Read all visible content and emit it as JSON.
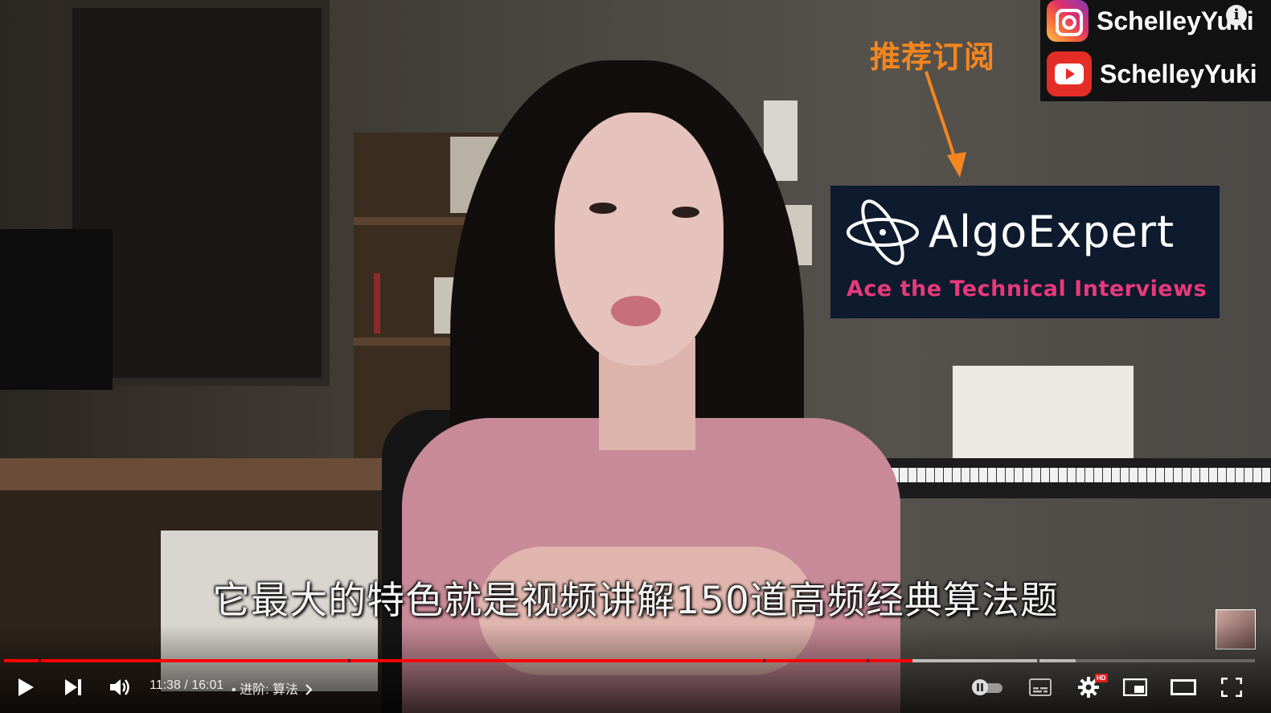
{
  "overlay": {
    "recommend_label": "推荐订阅",
    "social": [
      {
        "platform": "instagram",
        "icon": "instagram-icon",
        "handle": "SchelleyYuki"
      },
      {
        "platform": "youtube",
        "icon": "youtube-icon",
        "handle": "SchelleyYuki"
      }
    ],
    "info_glyph": "i"
  },
  "ad": {
    "brand": "AlgoExpert",
    "tagline": "Ace the Technical Interviews",
    "logo_icon": "atom-logo-icon",
    "colors": {
      "background": "#0e1a2d",
      "tagline": "#e8397b",
      "brand": "#ffffff"
    }
  },
  "subtitle": "它最大的特色就是视频讲解150道高频经典算法题",
  "controls": {
    "current_time": "11:38",
    "duration": "16:01",
    "time_separator": " / ",
    "chapter_prefix": "•",
    "chapter": "进阶: 算法",
    "progress_played_fraction": 0.7265,
    "progress_buffered_fraction": 0.857,
    "hd_badge": "HD",
    "buttons": {
      "play": "play-icon",
      "next": "next-icon",
      "volume": "volume-icon",
      "autoplay": "autoplay-toggle-icon",
      "subtitles": "subtitles-icon",
      "settings": "gear-icon",
      "miniplayer": "miniplayer-icon",
      "theater": "theater-mode-icon",
      "fullscreen": "fullscreen-icon"
    },
    "colors": {
      "played": "#ff0000",
      "buffered": "rgba(255,255,255,0.55)",
      "track": "rgba(255,255,255,0.25)"
    }
  }
}
